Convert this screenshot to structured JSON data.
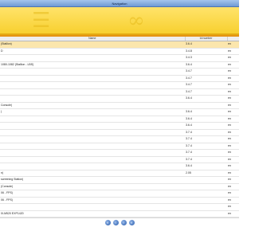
{
  "window": {
    "title": "Navigation"
  },
  "table": {
    "headers": [
      "Name",
      "Id number",
      ""
    ],
    "rows": [
      {
        "name": "(Stallion)",
        "version": "3.6.4",
        "lang": "en",
        "selected": true
      },
      {
        "name": "D",
        "version": "3.4.8",
        "lang": "en",
        "selected": false
      },
      {
        "name": "",
        "version": "3.4.3",
        "lang": "en",
        "selected": false
      },
      {
        "name": "1080-1082 (Stallion - LBS)",
        "version": "3.6.4",
        "lang": "en",
        "selected": false
      },
      {
        "name": "",
        "version": "3.4.7",
        "lang": "en",
        "selected": false
      },
      {
        "name": "",
        "version": "3.4.7",
        "lang": "en",
        "selected": false
      },
      {
        "name": "",
        "version": "3.4.7",
        "lang": "en",
        "selected": false
      },
      {
        "name": "",
        "version": "3.4.7",
        "lang": "en",
        "selected": false
      },
      {
        "name": "",
        "version": "3.6.4",
        "lang": "en",
        "selected": false
      },
      {
        "name": "Console)",
        "version": "",
        "lang": "en",
        "selected": false
      },
      {
        "name": ")",
        "version": "3.6.4",
        "lang": "en",
        "selected": false
      },
      {
        "name": "",
        "version": "3.6.4",
        "lang": "en",
        "selected": false
      },
      {
        "name": "",
        "version": "3.6.4",
        "lang": "en",
        "selected": false
      },
      {
        "name": "",
        "version": "3.7.4",
        "lang": "en",
        "selected": false
      },
      {
        "name": "",
        "version": "3.7.4",
        "lang": "en",
        "selected": false
      },
      {
        "name": "",
        "version": "3.7.4",
        "lang": "en",
        "selected": false
      },
      {
        "name": "",
        "version": "3.7.4",
        "lang": "en",
        "selected": false
      },
      {
        "name": "",
        "version": "3.7.4",
        "lang": "en",
        "selected": false
      },
      {
        "name": "",
        "version": "3.6.4",
        "lang": "en",
        "selected": false
      },
      {
        "name": "n)",
        "version": "2.05",
        "lang": "en",
        "selected": false
      },
      {
        "name": "screening Station)",
        "version": "",
        "lang": "en",
        "selected": false
      },
      {
        "name": "(Console)",
        "version": "",
        "lang": "en",
        "selected": false
      },
      {
        "name": "06 - FPS)",
        "version": "",
        "lang": "en",
        "selected": false
      },
      {
        "name": "06 - FPS)",
        "version": "",
        "lang": "en",
        "selected": false
      },
      {
        "name": "",
        "version": "",
        "lang": "en",
        "selected": false
      },
      {
        "name": "0I-M520 EXP1420",
        "version": "",
        "lang": "en",
        "selected": false
      }
    ]
  },
  "pager": {
    "buttons": [
      {
        "label": "«",
        "icon": "first-page-icon"
      },
      {
        "label": "‹",
        "icon": "prev-page-icon"
      },
      {
        "label": "›",
        "icon": "next-page-icon"
      },
      {
        "label": "»",
        "icon": "last-page-icon"
      }
    ]
  }
}
